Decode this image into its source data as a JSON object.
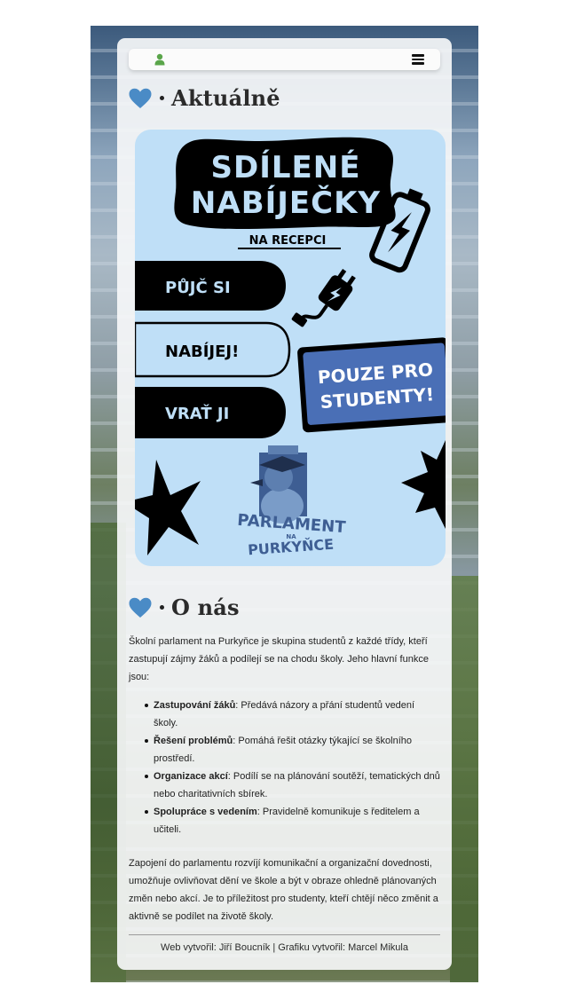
{
  "colors": {
    "accent": "#4a8bc6",
    "poster_bg": "#bfdff7",
    "user_icon": "#5aa54a",
    "badge_blue": "#4a6fb6"
  },
  "navbar": {
    "user_icon": "user-icon",
    "menu_icon": "hamburger-icon"
  },
  "sections": {
    "aktualne": {
      "title": "Aktuálně"
    },
    "onas": {
      "title": "O nás"
    }
  },
  "poster": {
    "title_line1": "SDÍLENÉ",
    "title_line2": "NABÍJEČKY",
    "subtitle": "NA RECEPCI",
    "step1": "PŮJČ SI",
    "step2": "NABÍJEJ!",
    "step3": "VRAŤ JI",
    "badge_line1": "POUZE PRO",
    "badge_line2": "STUDENTY!",
    "logo_line1": "PARLAMENT",
    "logo_small": "NA",
    "logo_line2": "PURKYŇCE"
  },
  "about": {
    "intro": "Školní parlament na Purkyňce je skupina studentů z každé třídy, kteří zastupují zájmy žáků a podílejí se na chodu školy. Jeho hlavní funkce jsou:",
    "items": [
      {
        "bold": "Zastupování žáků",
        "text": ": Předává názory a přání studentů vedení školy."
      },
      {
        "bold": "Řešení problémů",
        "text": ": Pomáhá řešit otázky týkající se školního prostředí."
      },
      {
        "bold": "Organizace akcí",
        "text": ": Podílí se na plánování soutěží, tematických dnů nebo charitativních sbírek."
      },
      {
        "bold": "Spolupráce s vedením",
        "text": ": Pravidelně komunikuje s ředitelem a učiteli."
      }
    ],
    "outro": "Zapojení do parlamentu rozvíjí komunikační a organizační dovednosti, umožňuje ovlivňovat dění ve škole a být v obraze ohledně plánovaných změn nebo akcí. Je to příležitost pro studenty, kteří chtějí něco změnit a aktivně se podílet na životě školy."
  },
  "footer": {
    "text": "Web vytvořil: Jiří Boucník | Grafiku vytvořil: Marcel Mikula"
  }
}
